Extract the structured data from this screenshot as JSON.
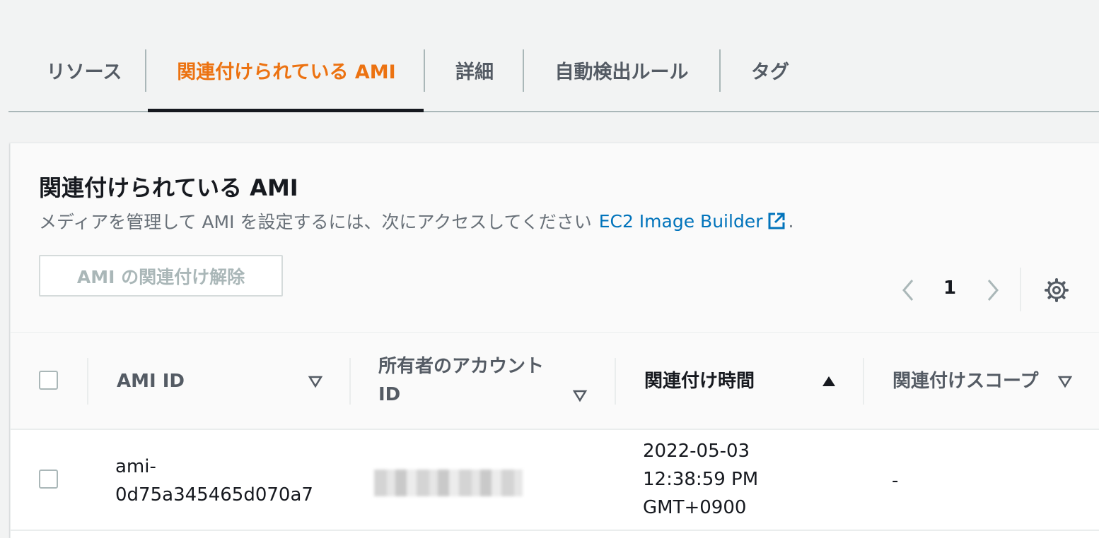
{
  "tabs": [
    {
      "label": "リソース",
      "active": false
    },
    {
      "label": "関連付けられている AMI",
      "active": true
    },
    {
      "label": "詳細",
      "active": false
    },
    {
      "label": "自動検出ルール",
      "active": false
    },
    {
      "label": "タグ",
      "active": false
    }
  ],
  "panel": {
    "title": "関連付けられている AMI",
    "description": "メディアを管理して AMI を設定するには、次にアクセスしてください",
    "link_text": "EC2 Image Builder",
    "link_suffix": ".",
    "disassociate_button": "AMI の関連付け解除"
  },
  "pagination": {
    "current_page": "1",
    "prev_icon": "chevron-left-icon",
    "next_icon": "chevron-right-icon",
    "settings_icon": "gear-icon"
  },
  "table": {
    "columns": [
      {
        "label": "AMI ID",
        "sort": "unsorted"
      },
      {
        "label_line1": "所有者のアカウント",
        "label_line2": "ID",
        "sort": "unsorted"
      },
      {
        "label": "関連付け時間",
        "sort": "ascending"
      },
      {
        "label": "関連付けスコープ",
        "sort": "unsorted"
      }
    ],
    "rows": [
      {
        "ami_id_line1": "ami-",
        "ami_id_line2": "0d75a345465d070a7",
        "owner_account_id": "",
        "time_line1": "2022-05-03",
        "time_line2": "12:38:59 PM",
        "time_line3": "GMT+0900",
        "scope": "-"
      }
    ]
  },
  "colors": {
    "active_tab": "#ec7211",
    "link": "#0073bb",
    "text": "#16191f",
    "muted": "#545b64",
    "disabled": "#aab7b8",
    "background": "#f2f3f3"
  }
}
